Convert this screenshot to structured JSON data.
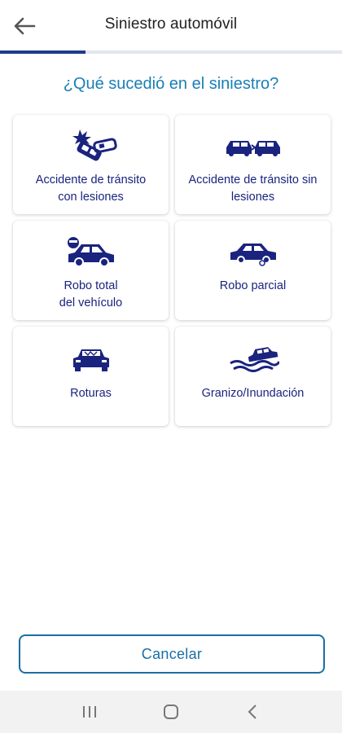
{
  "header": {
    "title": "Siniestro automóvil",
    "back_icon": "arrow-left-icon"
  },
  "progress": {
    "fraction": 0.25
  },
  "question": "¿Qué sucedió en el siniestro?",
  "options": [
    {
      "icon": "car-crash-injury-icon",
      "label": "Accidente de tránsito\ncon lesiones"
    },
    {
      "icon": "car-collision-icon",
      "label": "Accidente de tránsito sin\nlesiones"
    },
    {
      "icon": "car-theft-total-icon",
      "label": "Robo total\ndel vehículo"
    },
    {
      "icon": "car-theft-partial-icon",
      "label": "Robo parcial"
    },
    {
      "icon": "car-broken-icon",
      "label": "Roturas"
    },
    {
      "icon": "car-flood-icon",
      "label": "Granizo/Inundación"
    }
  ],
  "cancel_label": "Cancelar",
  "navbar": {
    "recents_icon": "recent-apps-icon",
    "home_icon": "home-icon",
    "back_icon": "back-chevron-icon"
  },
  "colors": {
    "primary": "#1a237e",
    "accent": "#1a7fb5",
    "progress": "#1e3a8a"
  }
}
